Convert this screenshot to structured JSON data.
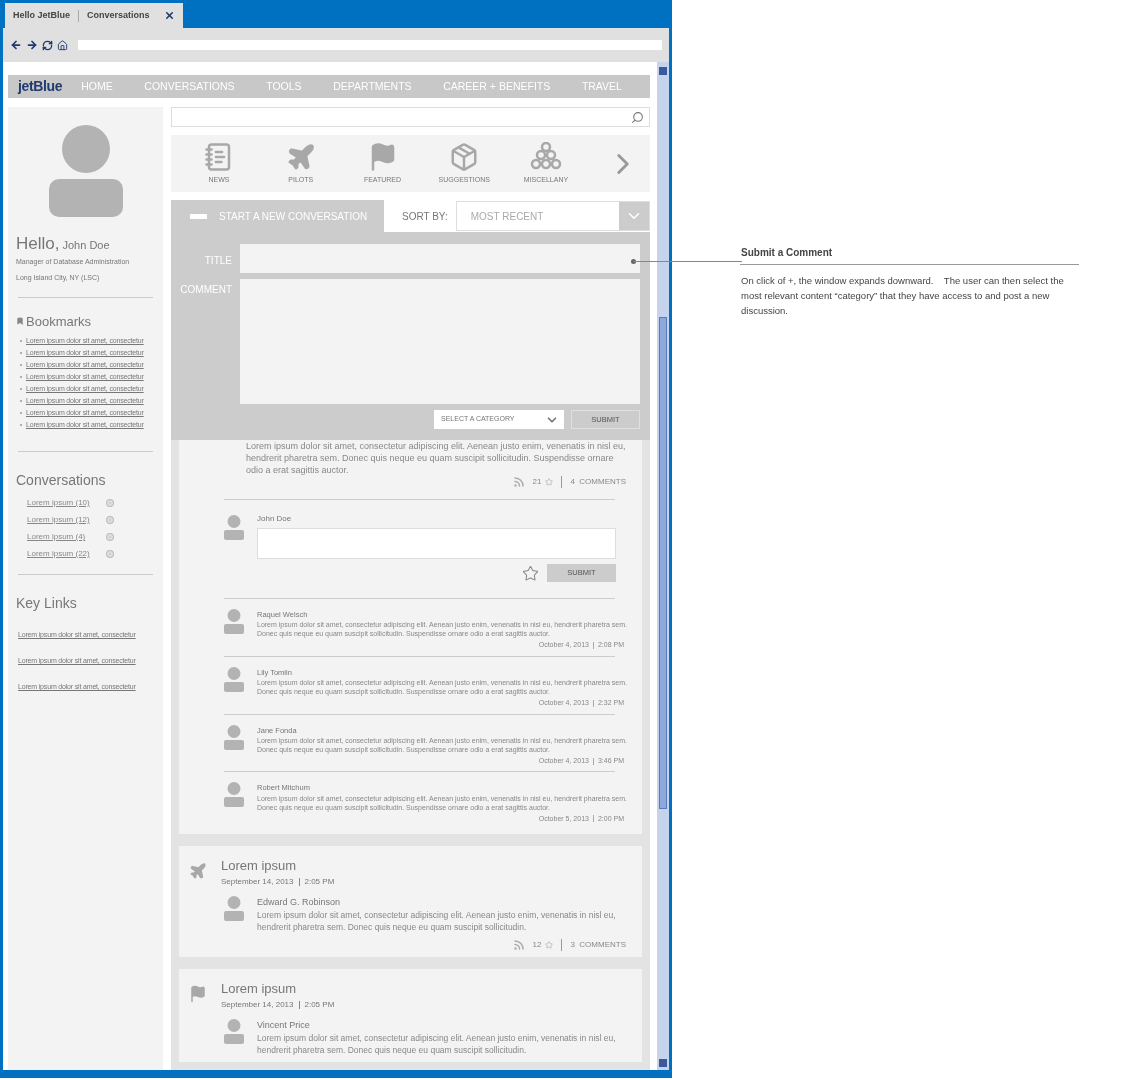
{
  "browser": {
    "tab": {
      "site": "Hello JetBlue",
      "page": "Conversations"
    }
  },
  "nav": {
    "logo": "jetBlue",
    "items": [
      "HOME",
      "CONVERSATIONS",
      "TOOLS",
      "DEPARTMENTS",
      "CAREER + BENEFITS",
      "TRAVEL"
    ]
  },
  "profile": {
    "greeting": "Hello,",
    "name": "John Doe",
    "role": "Manager of Database Administration",
    "location": "Long Island City, NY (LSC)"
  },
  "bookmarks": {
    "heading": "Bookmarks",
    "items": [
      "Lorem ipsum dolor sit amet, consectetur",
      "Lorem ipsum dolor sit amet, consectetur",
      "Lorem ipsum dolor sit amet, consectetur",
      "Lorem ipsum dolor sit amet, consectetur",
      "Lorem ipsum dolor sit amet, consectetur",
      "Lorem ipsum dolor sit amet, consectetur",
      "Lorem ipsum dolor sit amet, consectetur",
      "Lorem ipsum dolor sit amet, consectetur"
    ]
  },
  "conversations": {
    "heading": "Conversations",
    "items": [
      "Lorem ipsum (10)",
      "Lorem ipsum (12)",
      "Lorem ipsum (4)",
      "Lorem ipsum (22)"
    ]
  },
  "key_links": {
    "heading": "Key Links",
    "items": [
      "Lorem ipsum dolor sit amet, consectetur",
      "Lorem ipsum dolor sit amet, consectetur",
      "Lorem ipsum dolor sit amet, consectetur"
    ]
  },
  "categories": [
    {
      "label": "NEWS",
      "kind": "news"
    },
    {
      "label": "PILOTS",
      "kind": "pilots"
    },
    {
      "label": "FEATURED",
      "kind": "featured"
    },
    {
      "label": "SUGGESTIONS",
      "kind": "suggestions"
    },
    {
      "label": "MISCELLANY",
      "kind": "miscellany"
    }
  ],
  "new_conversation": {
    "expanded": true,
    "label": "START A NEW CONVERSATION",
    "title_label": "TITLE",
    "comment_label": "COMMENT",
    "category": "SELECT A CATEGORY",
    "submit": "SUBMIT"
  },
  "sort": {
    "label": "SORT BY:",
    "value": "MOST RECENT"
  },
  "feed": [
    {
      "body": "Lorem ipsum dolor sit amet, consectetur adipiscing elit. Aenean justo enim, venenatis in nisl eu, hendrerit pharetra sem. Donec quis neque eu quam suscipit sollicitudin. Suspendisse ornare odio a erat sagittis auctor.",
      "rating": "21",
      "comments": "4  COMMENTS",
      "reply": {
        "author": "John Doe",
        "submit": "SUBMIT"
      },
      "thread": [
        {
          "author": "Raquel Welsch",
          "text": "Lorem ipsum dolor sit amet, consectetur adipiscing elit. Aenean justo enim, venenatis in nisl eu, hendrerit pharetra sem. Donec quis neque eu quam suscipit sollicitudin. Suspendisse ornare odio a erat sagittis auctor.",
          "date": "October 4, 2013",
          "time": "2:08 PM"
        },
        {
          "author": "Lily Tomlin",
          "text": "Lorem ipsum dolor sit amet, consectetur adipiscing elit. Aenean justo enim, venenatis in nisl eu, hendrerit pharetra sem. Donec quis neque eu quam suscipit sollicitudin. Suspendisse ornare odio a erat sagittis auctor.",
          "date": "October 4, 2013",
          "time": "2:32 PM"
        },
        {
          "author": "Jane Fonda",
          "text": "Lorem ipsum dolor sit amet, consectetur adipiscing elit. Aenean justo enim, venenatis in nisl eu, hendrerit pharetra sem. Donec quis neque eu quam suscipit sollicitudin. Suspendisse ornare odio a erat sagittis auctor.",
          "date": "October 4, 2013",
          "time": "3:46 PM"
        },
        {
          "author": "Robert Mitchum",
          "text": "Lorem ipsum dolor sit amet, consectetur adipiscing elit. Aenean justo enim, venenatis in nisl eu, hendrerit pharetra sem. Donec quis neque eu quam suscipit sollicitudin. Suspendisse ornare odio a erat sagittis auctor.",
          "date": "October 5, 2013",
          "time": "2:00 PM"
        }
      ]
    },
    {
      "kind": "pilots",
      "title": "Lorem ipsum",
      "date": "September 14, 2013",
      "time": "2:05 PM",
      "author": "Edward G. Robinson",
      "body": "Lorem ipsum dolor sit amet, consectetur adipiscing elit. Aenean justo enim, venenatis in nisl eu, hendrerit pharetra sem. Donec quis neque eu quam suscipit sollicitudin.",
      "rating": "12",
      "comments": "3  COMMENTS"
    },
    {
      "kind": "featured",
      "title": "Lorem ipsum",
      "date": "September 14, 2013",
      "time": "2:05 PM",
      "author": "Vincent Price",
      "body": "Lorem ipsum dolor sit amet, consectetur adipiscing elit. Aenean justo enim, venenatis in nisl eu, hendrerit pharetra sem. Donec quis neque eu quam suscipit sollicitudin."
    }
  ],
  "annotation": {
    "title": "Submit a Comment",
    "text": "On click of +, the window expands downward.    The user can then select the most relevant content “category” that they have access to and post a new discussion."
  }
}
